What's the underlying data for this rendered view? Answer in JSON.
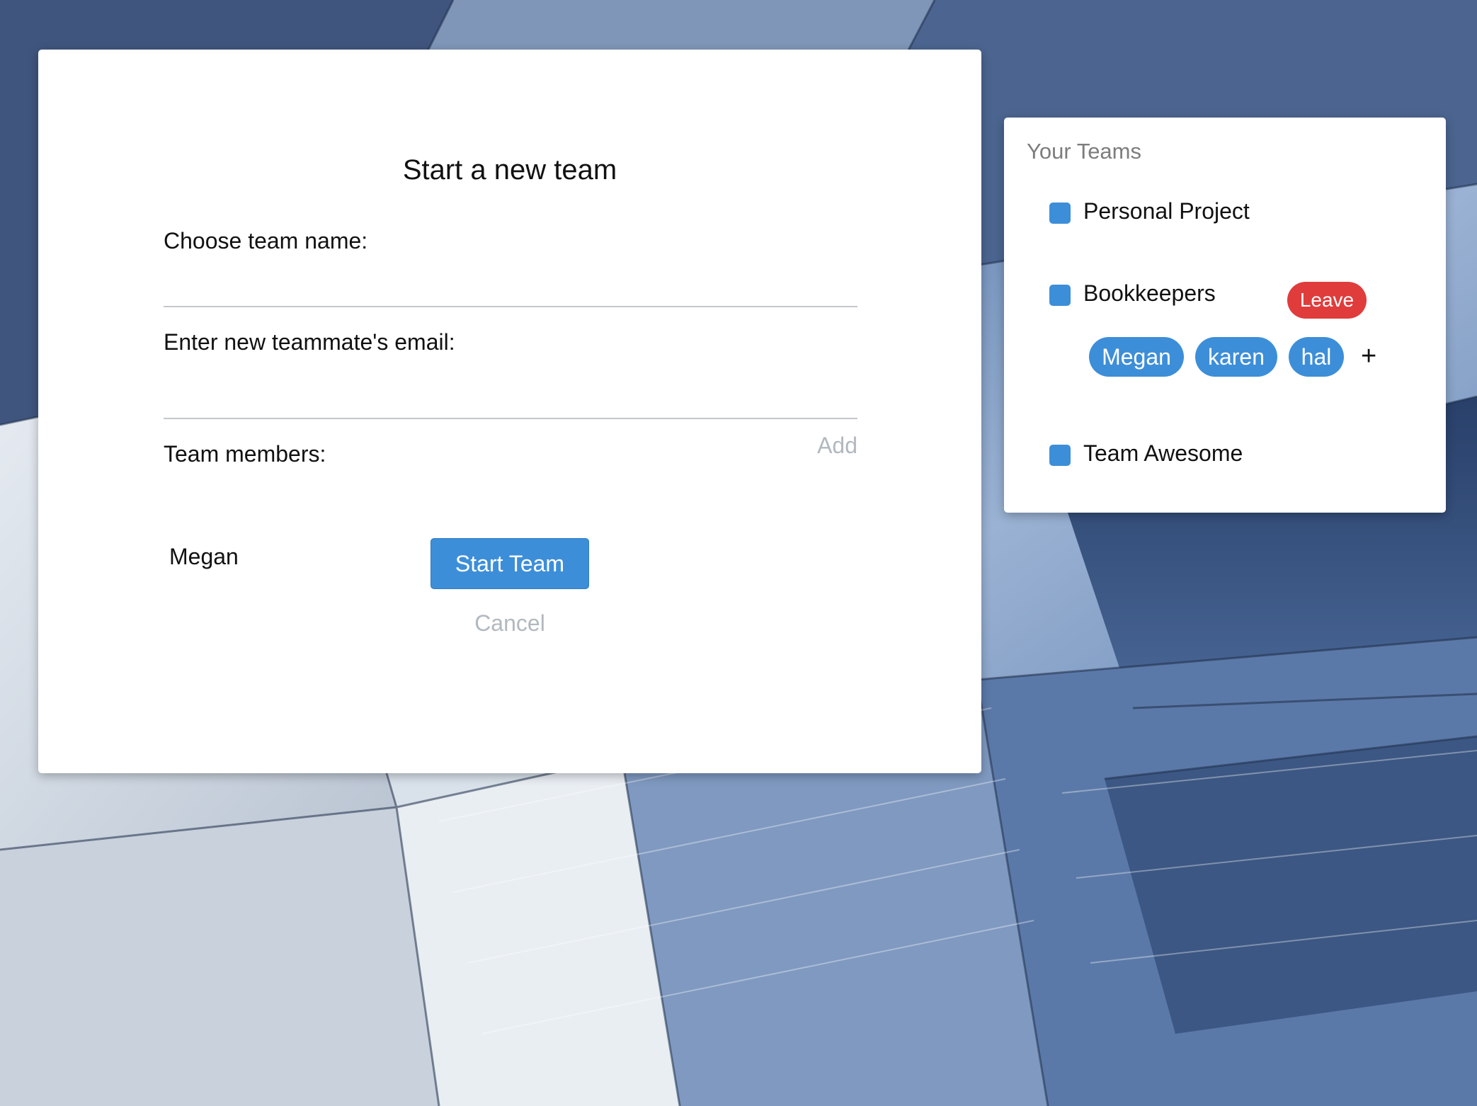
{
  "modal": {
    "title": "Start a new team",
    "team_name_label": "Choose team name:",
    "team_name_value": "",
    "email_label": "Enter new teammate's email:",
    "email_value": "",
    "add_label": "Add",
    "members_label": "Team members:",
    "members": [
      "Megan"
    ],
    "start_button_label": "Start Team",
    "cancel_label": "Cancel"
  },
  "teams_panel": {
    "title": "Your Teams",
    "teams": [
      {
        "name": "Personal Project"
      },
      {
        "name": "Bookkeepers",
        "leave_label": "Leave",
        "members": [
          "Megan",
          "karen",
          "hal"
        ],
        "add_member_label": "+"
      },
      {
        "name": "Team Awesome"
      }
    ]
  },
  "colors": {
    "accent": "#3d8ed8",
    "danger": "#e03c3c",
    "muted_text": "#b2b8bf",
    "panel_title": "#7d7d7d"
  },
  "icons": {
    "team_marker": "blue-square-icon",
    "add_member": "plus-icon"
  }
}
